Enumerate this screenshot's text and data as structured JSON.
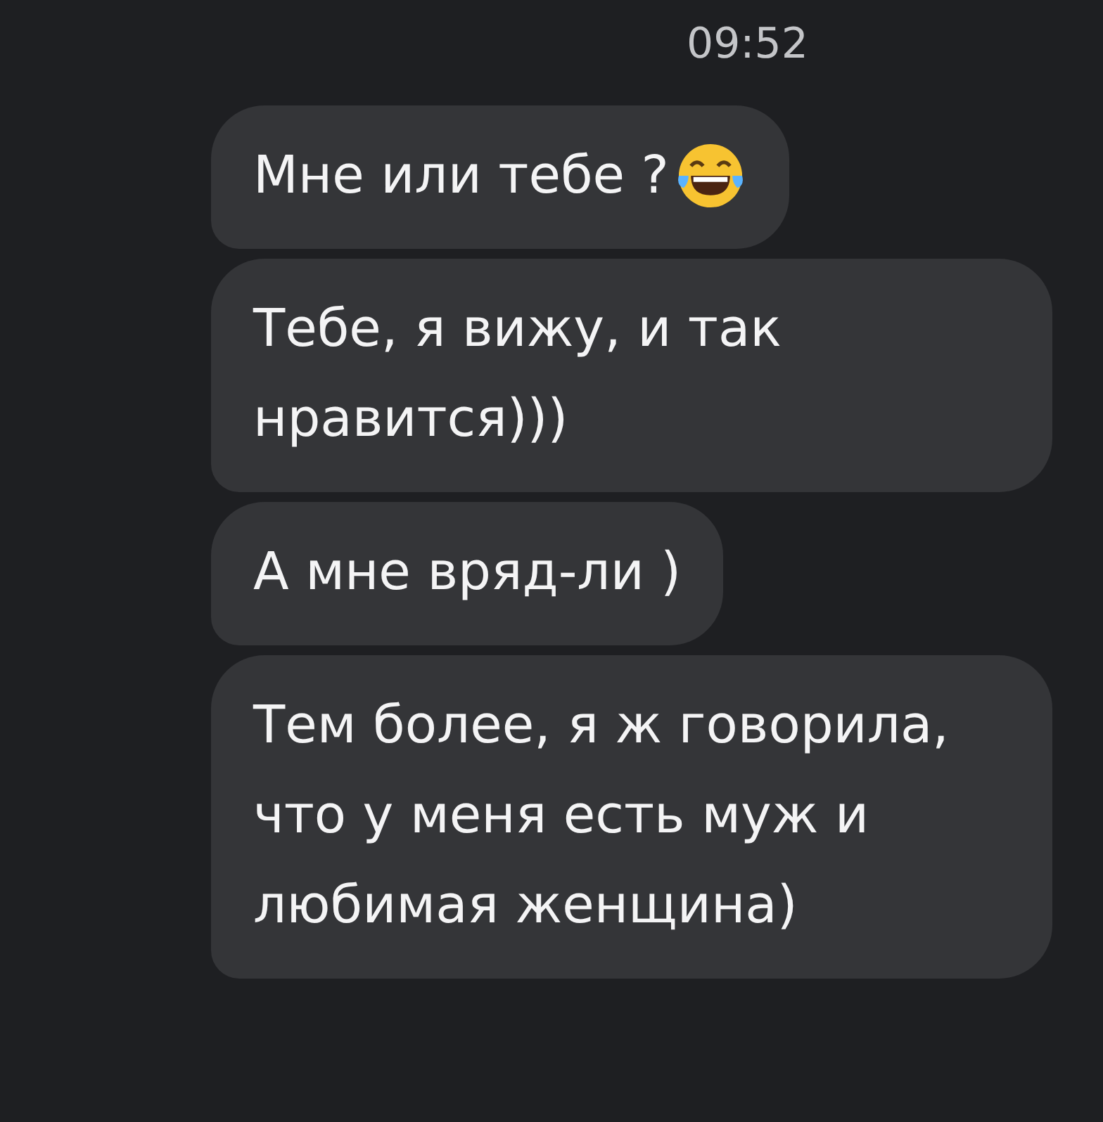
{
  "time": "09:52",
  "messages": [
    {
      "text": "Мне или тебе ?",
      "emoji": true
    },
    {
      "text": "Тебе, я вижу, и так нравится)))",
      "emoji": false
    },
    {
      "text": "А мне вряд-ли )",
      "emoji": false
    },
    {
      "text": "Тем более, я ж говорила, что у меня есть муж и любимая женщина)",
      "emoji": false
    }
  ]
}
